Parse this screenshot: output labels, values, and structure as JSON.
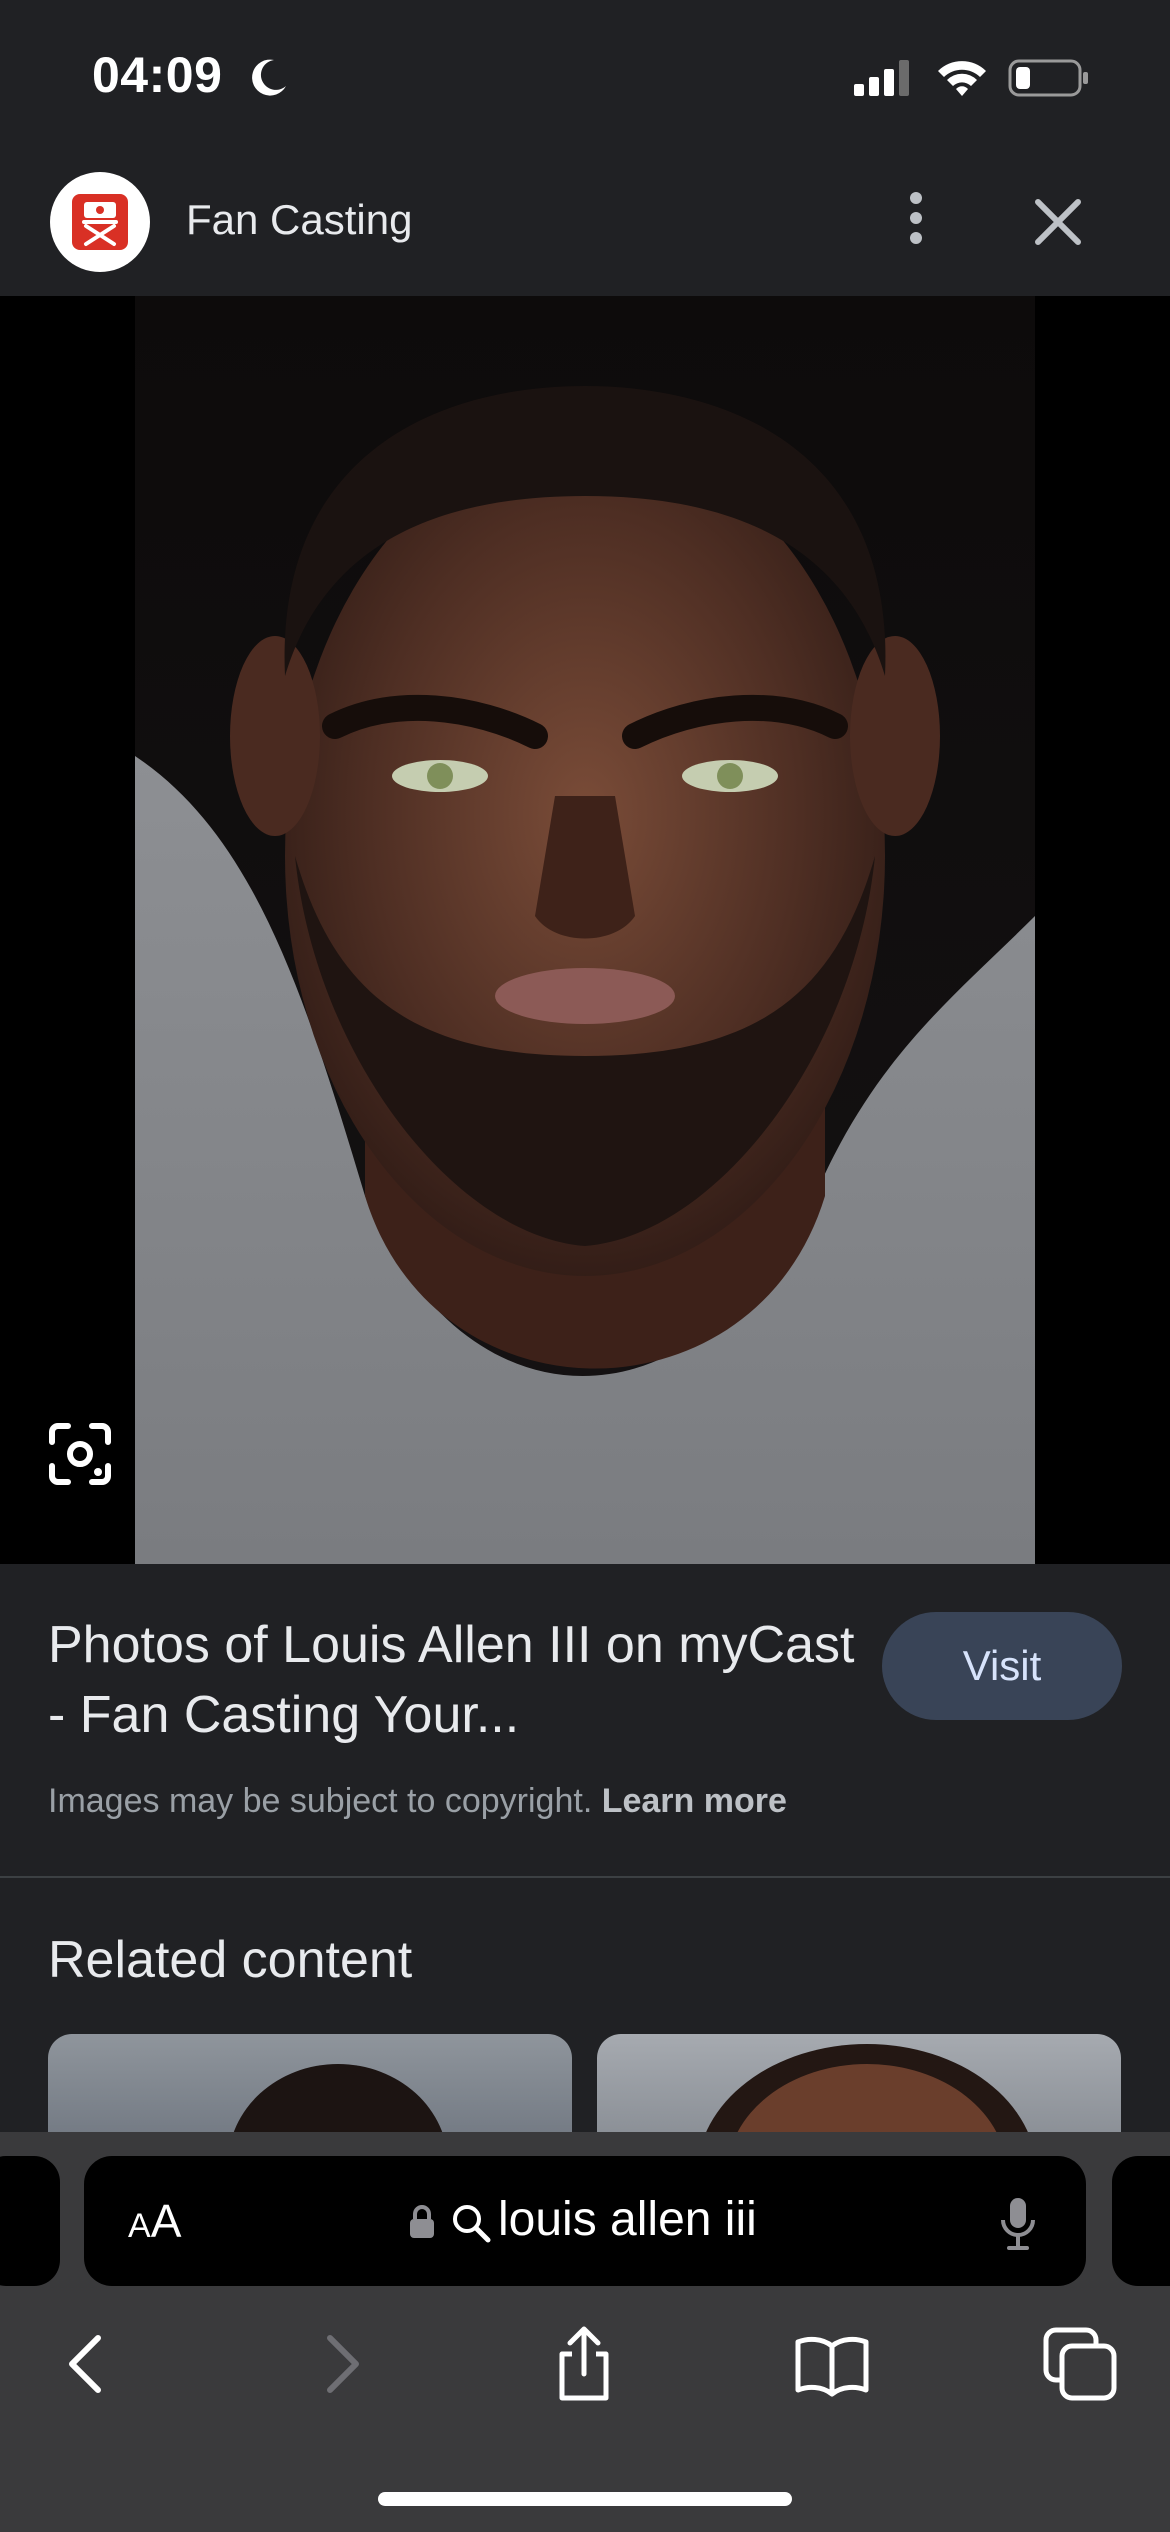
{
  "status_bar": {
    "time": "04:09"
  },
  "header": {
    "site_title": "Fan Casting"
  },
  "result": {
    "title": "Photos of Louis Allen III on myCast - Fan Casting Your...",
    "visit_label": "Visit",
    "copyright_text": "Images may be subject to copyright.",
    "learn_more": "Learn more"
  },
  "related": {
    "title": "Related content"
  },
  "safari": {
    "aa_small": "A",
    "aa_large": "A",
    "url": "louis allen iii"
  },
  "icons": {
    "moon": "moon-icon",
    "signal": "cellular-signal-icon",
    "wifi": "wifi-icon",
    "battery": "battery-icon",
    "more": "more-vert-icon",
    "close": "close-icon",
    "lens": "lens-icon",
    "lock": "lock-icon",
    "search": "search-icon",
    "mic": "microphone-icon",
    "back": "chevron-left-icon",
    "forward": "chevron-right-icon",
    "share": "share-icon",
    "bookmarks": "book-icon",
    "tabs": "tabs-icon"
  },
  "colors": {
    "background": "#202124",
    "visit_button": "#394457",
    "safari_bar": "#3a3a3c",
    "logo_red": "#d93025"
  }
}
